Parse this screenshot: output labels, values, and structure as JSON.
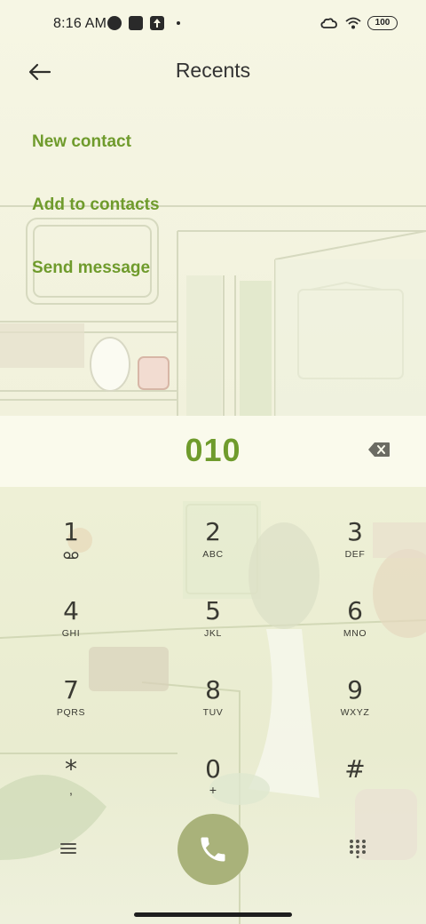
{
  "status_bar": {
    "time": "8:16 AM",
    "left_icons": [
      "app-notification-icon",
      "square-notification-icon",
      "upload-icon",
      "more-dot-icon"
    ],
    "right_icons": [
      "cloud-signal-icon",
      "wifi-icon"
    ],
    "battery": "100"
  },
  "header": {
    "back_icon": "arrow-left-icon",
    "title": "Recents"
  },
  "actions": {
    "new_contact": "New contact",
    "add_to_contacts": "Add to contacts",
    "send_message": "Send message"
  },
  "dial": {
    "number": "010",
    "backspace_icon": "backspace-icon"
  },
  "keypad": {
    "keys": [
      {
        "digit": "1",
        "letters": "",
        "icon": "voicemail-icon"
      },
      {
        "digit": "2",
        "letters": "ABC"
      },
      {
        "digit": "3",
        "letters": "DEF"
      },
      {
        "digit": "4",
        "letters": "GHI"
      },
      {
        "digit": "5",
        "letters": "JKL"
      },
      {
        "digit": "6",
        "letters": "MNO"
      },
      {
        "digit": "7",
        "letters": "PQRS"
      },
      {
        "digit": "8",
        "letters": "TUV"
      },
      {
        "digit": "9",
        "letters": "WXYZ"
      },
      {
        "digit": "*",
        "letters": ","
      },
      {
        "digit": "0",
        "letters": "+"
      },
      {
        "digit": "#",
        "letters": ""
      }
    ]
  },
  "bottom": {
    "menu_icon": "menu-icon",
    "call_icon": "phone-icon",
    "dialpad_icon": "dialpad-icon"
  },
  "colors": {
    "accent": "#6f9b2c",
    "call_button": "#a9b27a",
    "background": "#f7f6e6"
  }
}
